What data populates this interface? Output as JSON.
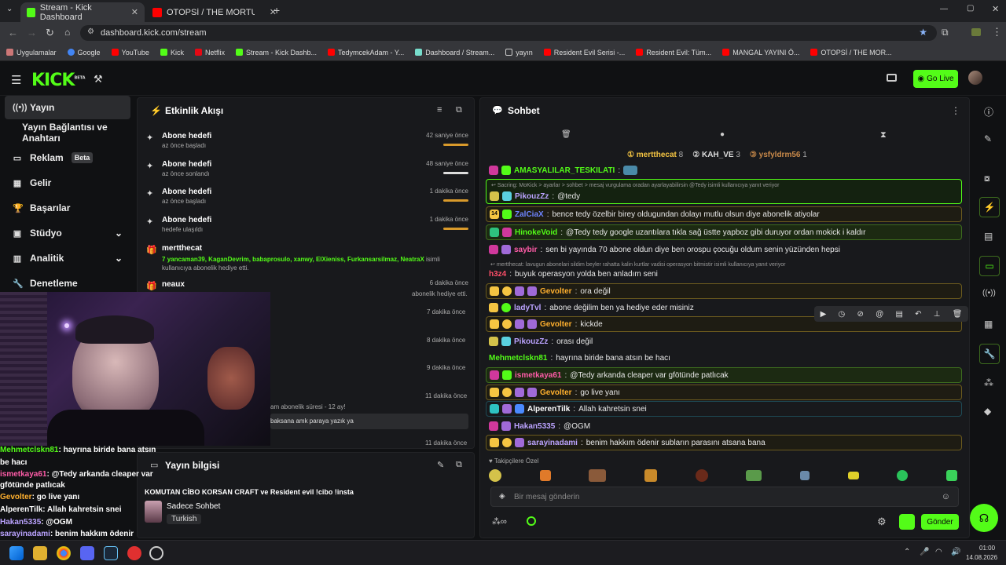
{
  "browser": {
    "tabs": [
      {
        "title": "Stream - Kick Dashboard",
        "close": "✕"
      },
      {
        "title": "OTOPSİ / THE MORTUARY ASS",
        "close": "✕"
      }
    ],
    "url": "dashboard.kick.com/stream",
    "bookmarks": [
      "Uygulamalar",
      "Google",
      "YouTube",
      "Kick",
      "Netflix",
      "Stream - Kick Dashb...",
      "TedymcekAdam - Y...",
      "Dashboard / Stream...",
      "yayın",
      "Resident Evil Serisi -...",
      "Resident Evil: Tüm...",
      "MANGAL YAYINI Ö...",
      "OTOPSİ / THE MOR..."
    ]
  },
  "header": {
    "logo": "KICK",
    "logo_sup": "BETA",
    "go_live": "Go Live"
  },
  "sidebar": {
    "items": [
      {
        "label": "Yayın",
        "icon": "broadcast-icon"
      },
      {
        "label": "Yayın Bağlantısı ve Anahtarı",
        "icon": ""
      },
      {
        "label": "Reklam",
        "icon": "ad-icon",
        "badge": "Beta"
      },
      {
        "label": "Gelir",
        "icon": "revenue-icon"
      },
      {
        "label": "Başarılar",
        "icon": "trophy-icon"
      },
      {
        "label": "Stüdyo",
        "icon": "studio-icon"
      },
      {
        "label": "Analitik",
        "icon": "analytics-icon"
      },
      {
        "label": "Denetleme",
        "icon": "moderation-icon"
      }
    ]
  },
  "activity": {
    "title": "Etkinlik Akışı",
    "events": [
      {
        "title": "Abone hedefi",
        "sub": "az önce başladı",
        "time": "42 saniye önce"
      },
      {
        "title": "Abone hedefi",
        "sub": "az önce sonlandı",
        "time": "48 saniye önce"
      },
      {
        "title": "Abone hedefi",
        "sub": "az önce başladı",
        "time": "1 dakika önce"
      },
      {
        "title": "Abone hedefi",
        "sub": "hedefe ulaşıldı",
        "time": "1 dakika önce"
      }
    ],
    "gift": {
      "user": "mertthecat",
      "count": "7",
      "names": "yancaman39, KaganDevrim, babaprosulo, xanwy, ElXieniss, Furkansarsilmaz, NeatraX",
      "suffix": "isimli kullanıcıya abonelik hediye etti."
    },
    "neaux": {
      "user": "neaux",
      "time": "6 dakika önce",
      "text": "abonelik hediye etti."
    },
    "times": [
      "7 dakika önce",
      "8 dakika önce",
      "9 dakika önce",
      "11 dakika önce"
    ],
    "partial1": "am abonelik süresi - 12 ay!",
    "partial2": "baksana amk paraya yazık ya",
    "partial_time": "11 dakika önce"
  },
  "stream_info": {
    "title": "Yayın bilgisi",
    "name": "KOMUTAN CİBO KORSAN CRAFT ve Resident evil !cibo !insta",
    "category": "Sadece Sohbet",
    "language": "Turkish"
  },
  "chat": {
    "title": "Sohbet",
    "top": [
      {
        "name": "mertthecat",
        "count": "8"
      },
      {
        "name": "KAH_VE",
        "count": "3"
      },
      {
        "name": "ysfyldrm56",
        "count": "1"
      }
    ],
    "reply_hint": "Sacring: MoKick > ayarlar > sohbet > mesaj vurgulama oradan ayarlayabilirsin @Tedy isimli kullanıcıya yanıt veriyor",
    "messages": [
      {
        "user": "AMASYALILAR_TESKILATI",
        "text": "",
        "color": "#53fc18"
      },
      {
        "user": "PikouzZz",
        "text": "@tedy",
        "color": "#bba3ff"
      },
      {
        "user": "ZalCiaX",
        "text": "bence tedy özelbir birey oldugundan dolayı mutlu olsun diye abonelik atiyolar",
        "color": "#6e84ff"
      },
      {
        "user": "HinokeVoid",
        "text": "@Tedy tedy google uzantılara tıkla sağ üstte yapboz gibi duruyor ordan mokick i kaldır",
        "color": "#53fc18"
      },
      {
        "user": "saybir",
        "text": "sen bi yayında 70 abone oldun diye ben orospu çocuğu oldum senin yüzünden hepsi",
        "color": "#ff5ca8"
      },
      {
        "user": "h3z4",
        "text": "buyuk operasyon yolda ben anladım seni",
        "color": "#ff4f6a"
      },
      {
        "user": "Gevolter",
        "text": "ora değil",
        "color": "#ffb02e"
      },
      {
        "user": "ladyTvl",
        "text": "abone değilim ben ya hediye eder misiniz",
        "color": "#bba3ff"
      },
      {
        "user": "Gevolter",
        "text": "kickde",
        "color": "#ffb02e"
      },
      {
        "user": "PikouzZz",
        "text": "orası değil",
        "color": "#bba3ff"
      },
      {
        "user": "Mehmetclskn81",
        "text": "hayrına biride bana atsın be hacı",
        "color": "#53fc18"
      },
      {
        "user": "ismetkaya61",
        "text": "@Tedy arkanda cleaper var gfötünde patlıcak",
        "color": "#ff5ca8"
      },
      {
        "user": "Gevolter",
        "text": "go live yanı",
        "color": "#ffb02e"
      },
      {
        "user": "AlperenTilk",
        "text": "Allah kahretsin snei",
        "color": "#ffffff"
      },
      {
        "user": "Hakan5335",
        "text": "@OGM",
        "color": "#bba3ff"
      },
      {
        "user": "sarayinadami",
        "text": "benim hakkım ödenir subların parasını atsana bana",
        "color": "#bba3ff"
      }
    ],
    "mertthecat_note": "mertthecat: lavugun abonelari sildim beyler rahatta kalin kurtlar vadisi operasyon bitmistir isimli kullanıcıya yanıt veriyor",
    "emote_label": "Takipçilere Özel",
    "input_placeholder": "Bir mesaj gönderin",
    "send": "Gönder"
  },
  "overlay": [
    {
      "user": "Mehmetclskn81",
      "text": "hayrına biride bana atsın be hacı"
    },
    {
      "user": "ismetkaya61",
      "text": "@Tedy arkanda cleaper var gfötünde patlıcak"
    },
    {
      "user": "Gevolter",
      "text": "go live yanı"
    },
    {
      "user": "AlperenTilk",
      "text": "Allah kahretsin snei"
    },
    {
      "user": "Hakan5335",
      "text": "@OGM"
    },
    {
      "user": "sarayinadami",
      "text": "benim hakkım ödenir subların parasını atsana bana"
    }
  ],
  "taskbar": {
    "time": "01:00",
    "date": "14.08.2026"
  }
}
